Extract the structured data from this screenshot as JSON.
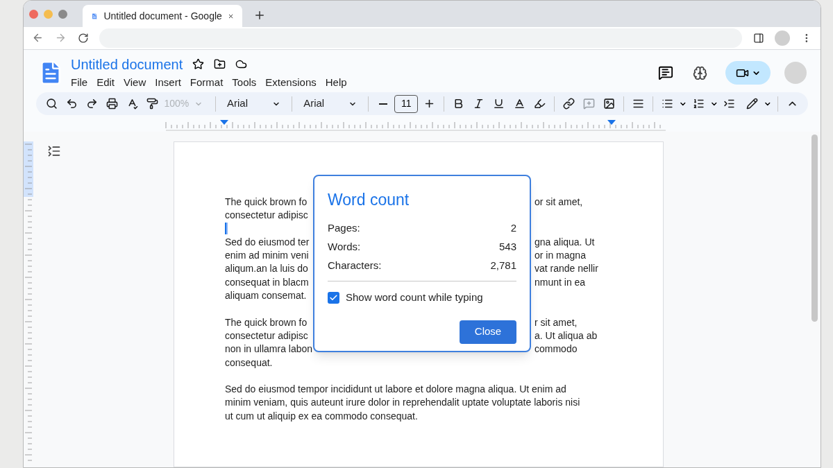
{
  "browser": {
    "tab": {
      "title": "Untitled document - Google"
    }
  },
  "doc": {
    "title": "Untitled document",
    "menu": [
      "File",
      "Edit",
      "View",
      "Insert",
      "Format",
      "Tools",
      "Extensions",
      "Help"
    ]
  },
  "toolbar": {
    "zoom": {
      "value": "100%",
      "disabled": true
    },
    "style": "Arial",
    "font": "Arial",
    "font_size": "11"
  },
  "document": {
    "paragraphs": [
      {
        "lines": [
          {
            "left": "The quick brown fo",
            "right": "or sit amet,"
          },
          {
            "left": "consectetur adipisc"
          }
        ]
      },
      {
        "lines": [
          {
            "left": "Sed do eiusmod ter",
            "right": "gna aliqua. Ut"
          },
          {
            "left": "enim ad minim veni",
            "right": "or in magna"
          },
          {
            "left": "aliqum.an la luis do",
            "right": "vat rande nellir"
          },
          {
            "left": "consequat in blacm",
            "right": "nmunt in ea"
          },
          {
            "left": "aliquam consemat."
          }
        ]
      },
      {
        "lines": [
          {
            "left": "The quick brown fo",
            "right": "r sit amet,"
          },
          {
            "left": "consectetur adipisc",
            "right": "a. Ut aliqua ab"
          },
          {
            "left": "non in ullamra labon",
            "right": "commodo"
          },
          {
            "text": "consequat."
          }
        ]
      },
      {
        "lines": [
          {
            "text": "Sed do eiusmod tempor incididunt ut labore et dolore magna aliqua. Ut enim ad"
          },
          {
            "text": "minim veniam, quis auteunt irure dolor in reprehendalit uptate voluptate laboris nisi"
          },
          {
            "text": "ut cum ut aliquip ex ea commodo consequat."
          }
        ]
      }
    ]
  },
  "dialog": {
    "title": "Word count",
    "stats": [
      {
        "label": "Pages:",
        "value": "2"
      },
      {
        "label": "Words:",
        "value": "543"
      },
      {
        "label": "Characters:",
        "value": "2,781"
      }
    ],
    "checkbox": {
      "label": "Show word count while typing",
      "checked": true
    },
    "button": "Close"
  }
}
